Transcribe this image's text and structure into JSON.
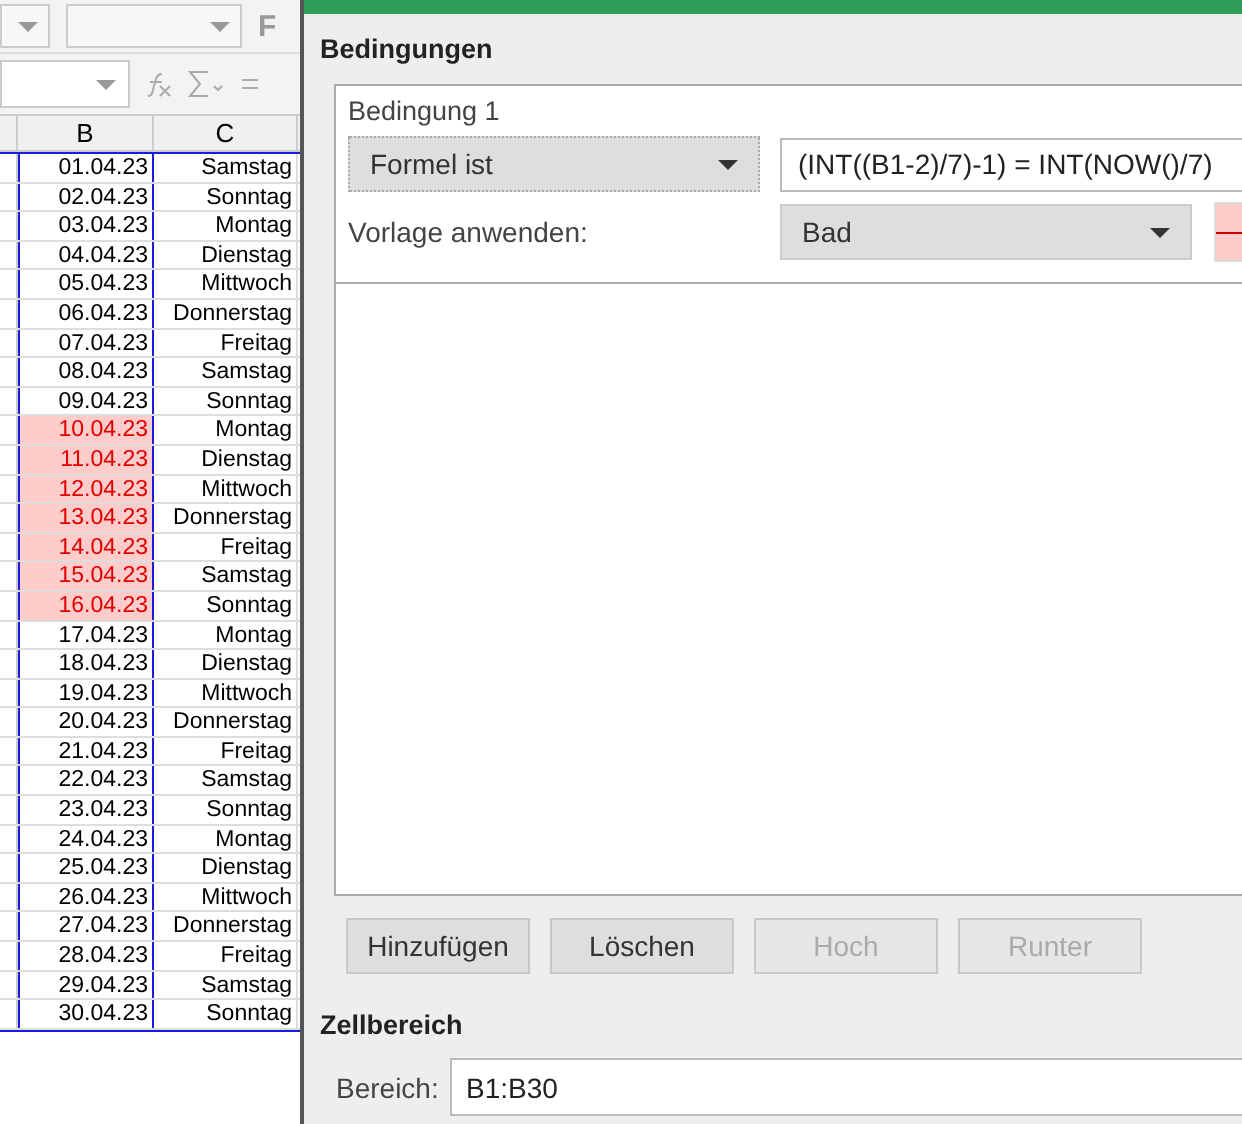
{
  "sheet": {
    "toolbar_letter": "F",
    "columns": [
      "B",
      "C"
    ],
    "rows": [
      {
        "date": "01.04.23",
        "day": "Samstag",
        "highlighted": false
      },
      {
        "date": "02.04.23",
        "day": "Sonntag",
        "highlighted": false
      },
      {
        "date": "03.04.23",
        "day": "Montag",
        "highlighted": false
      },
      {
        "date": "04.04.23",
        "day": "Dienstag",
        "highlighted": false
      },
      {
        "date": "05.04.23",
        "day": "Mittwoch",
        "highlighted": false
      },
      {
        "date": "06.04.23",
        "day": "Donnerstag",
        "highlighted": false
      },
      {
        "date": "07.04.23",
        "day": "Freitag",
        "highlighted": false
      },
      {
        "date": "08.04.23",
        "day": "Samstag",
        "highlighted": false
      },
      {
        "date": "09.04.23",
        "day": "Sonntag",
        "highlighted": false
      },
      {
        "date": "10.04.23",
        "day": "Montag",
        "highlighted": true
      },
      {
        "date": "11.04.23",
        "day": "Dienstag",
        "highlighted": true
      },
      {
        "date": "12.04.23",
        "day": "Mittwoch",
        "highlighted": true
      },
      {
        "date": "13.04.23",
        "day": "Donnerstag",
        "highlighted": true
      },
      {
        "date": "14.04.23",
        "day": "Freitag",
        "highlighted": true
      },
      {
        "date": "15.04.23",
        "day": "Samstag",
        "highlighted": true
      },
      {
        "date": "16.04.23",
        "day": "Sonntag",
        "highlighted": true
      },
      {
        "date": "17.04.23",
        "day": "Montag",
        "highlighted": false
      },
      {
        "date": "18.04.23",
        "day": "Dienstag",
        "highlighted": false
      },
      {
        "date": "19.04.23",
        "day": "Mittwoch",
        "highlighted": false
      },
      {
        "date": "20.04.23",
        "day": "Donnerstag",
        "highlighted": false
      },
      {
        "date": "21.04.23",
        "day": "Freitag",
        "highlighted": false
      },
      {
        "date": "22.04.23",
        "day": "Samstag",
        "highlighted": false
      },
      {
        "date": "23.04.23",
        "day": "Sonntag",
        "highlighted": false
      },
      {
        "date": "24.04.23",
        "day": "Montag",
        "highlighted": false
      },
      {
        "date": "25.04.23",
        "day": "Dienstag",
        "highlighted": false
      },
      {
        "date": "26.04.23",
        "day": "Mittwoch",
        "highlighted": false
      },
      {
        "date": "27.04.23",
        "day": "Donnerstag",
        "highlighted": false
      },
      {
        "date": "28.04.23",
        "day": "Freitag",
        "highlighted": false
      },
      {
        "date": "29.04.23",
        "day": "Samstag",
        "highlighted": false
      },
      {
        "date": "30.04.23",
        "day": "Sonntag",
        "highlighted": false
      }
    ]
  },
  "dialog": {
    "conditions_heading": "Bedingungen",
    "condition": {
      "label": "Bedingung 1",
      "type": "Formel ist",
      "formula": "(INT((B1-2)/7)-1) = INT(NOW()/7)",
      "style_label": "Vorlage anwenden:",
      "style": "Bad"
    },
    "buttons": [
      {
        "label": "Hinzufügen",
        "disabled": false
      },
      {
        "label": "Löschen",
        "disabled": false
      },
      {
        "label": "Hoch",
        "disabled": true
      },
      {
        "label": "Runter",
        "disabled": true
      }
    ],
    "range_heading": "Zellbereich",
    "range_label": "Bereich:",
    "range": "B1:B30"
  }
}
